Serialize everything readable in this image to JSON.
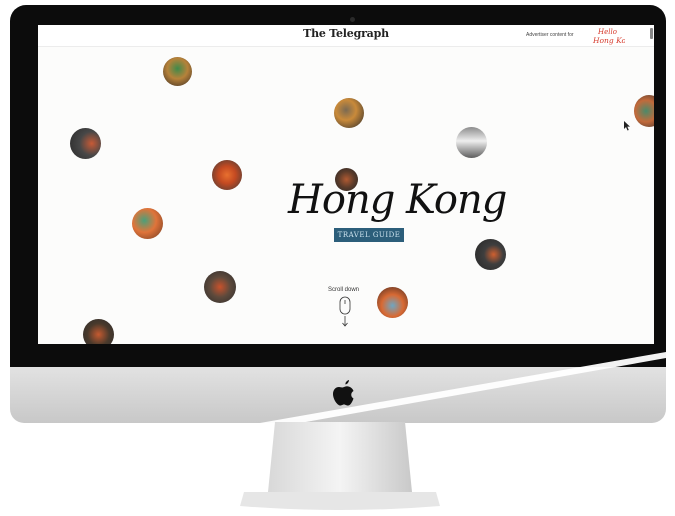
{
  "site": {
    "brand": "The Telegraph",
    "advertiser_label": "Advertiser content for",
    "partner_logo": "Hello Hong Kong"
  },
  "hero": {
    "title": "Hong Kong",
    "subtitle": "TRAVEL GUIDE"
  },
  "scroll_hint": {
    "label": "Scroll down",
    "icon": "mouse-scroll-icon"
  },
  "device": {
    "logo_icon": "apple-logo-icon"
  },
  "colors": {
    "accent": "#2c5e7a",
    "partner_red": "#d63a2c",
    "frame": "#0c0c0c"
  }
}
